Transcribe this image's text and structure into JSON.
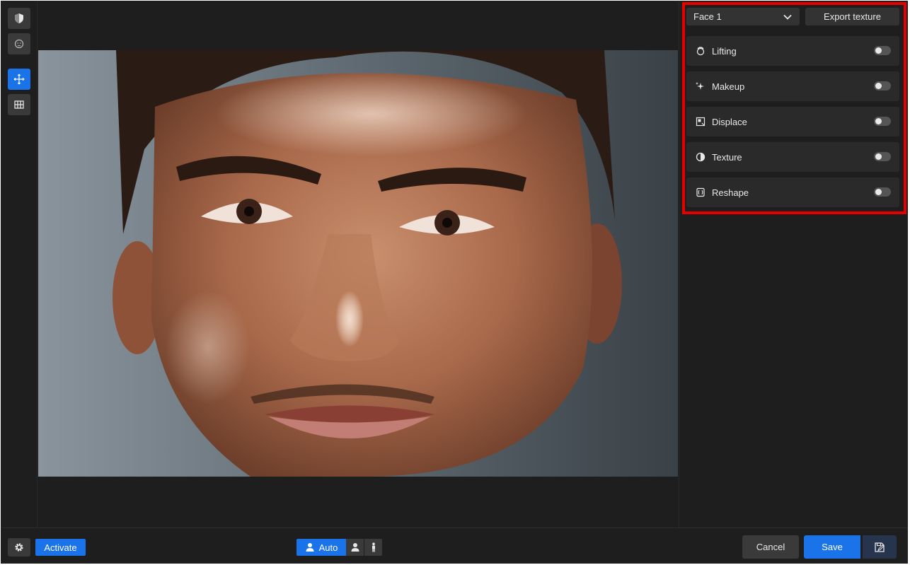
{
  "colors": {
    "accent": "#1a73e8",
    "background": "#1e1e1e",
    "panel_row": "#2a2a2a",
    "highlight": "#e60000"
  },
  "left_toolbar": {
    "tools": [
      {
        "icon": "shield-icon",
        "active": false
      },
      {
        "icon": "face-icon",
        "active": false
      },
      {
        "icon": "move-icon",
        "active": true
      },
      {
        "icon": "grid-icon",
        "active": false
      }
    ]
  },
  "canvas": {
    "image": "close-up portrait of a man's face"
  },
  "right_panel": {
    "face_select": {
      "value": "Face 1",
      "icon": "chevron-down-icon"
    },
    "export_label": "Export texture",
    "features": [
      {
        "label": "Lifting",
        "icon": "lifting-icon",
        "enabled": false
      },
      {
        "label": "Makeup",
        "icon": "sparkle-icon",
        "enabled": false
      },
      {
        "label": "Displace",
        "icon": "displace-icon",
        "enabled": false
      },
      {
        "label": "Texture",
        "icon": "texture-icon",
        "enabled": false
      },
      {
        "label": "Reshape",
        "icon": "reshape-icon",
        "enabled": false
      }
    ]
  },
  "bottom_bar": {
    "settings_icon": "gear-icon",
    "activate_label": "Activate",
    "mode": {
      "auto_label": "Auto",
      "icons": [
        "person-icon",
        "portrait-icon",
        "full-body-icon"
      ]
    },
    "cancel_label": "Cancel",
    "save_label": "Save",
    "save_as_icon": "save-edit-icon"
  }
}
